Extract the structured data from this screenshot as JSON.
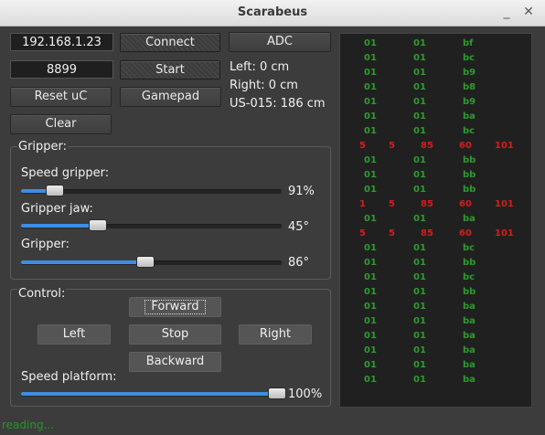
{
  "window": {
    "title": "Scarabeus",
    "minimize_glyph": "_",
    "close_glyph": "✕"
  },
  "connection": {
    "ip": "192.168.1.23",
    "port": "8899",
    "connect_label": "Connect",
    "start_label": "Start",
    "adc_label": "ADC"
  },
  "buttons": {
    "reset_label": "Reset uC",
    "gamepad_label": "Gamepad",
    "clear_label": "Clear"
  },
  "sensors": {
    "left": "Left: 0 cm",
    "right": "Right: 0 cm",
    "us": "US-015: 186 cm"
  },
  "gripper": {
    "title": "Gripper:",
    "speed": {
      "label": "Speed gripper:",
      "value": 0.1,
      "text": "91%"
    },
    "jaw": {
      "label": "Gripper jaw:",
      "value": 0.27,
      "text": "45°"
    },
    "grip": {
      "label": "Gripper:",
      "value": 0.46,
      "text": "86°"
    }
  },
  "control": {
    "title": "Control:",
    "forward": "Forward",
    "left": "Left",
    "stop": "Stop",
    "right": "Right",
    "backward": "Backward",
    "speed_label": "Speed platform:",
    "speed_value": 0.99,
    "speed_text": "100%"
  },
  "console_rows": [
    {
      "kind": "ok",
      "cells": [
        "01",
        "01",
        "bf"
      ]
    },
    {
      "kind": "ok",
      "cells": [
        "01",
        "01",
        "bc"
      ]
    },
    {
      "kind": "ok",
      "cells": [
        "01",
        "01",
        "b9"
      ]
    },
    {
      "kind": "ok",
      "cells": [
        "01",
        "01",
        "b8"
      ]
    },
    {
      "kind": "ok",
      "cells": [
        "01",
        "01",
        "b9"
      ]
    },
    {
      "kind": "ok",
      "cells": [
        "01",
        "01",
        "ba"
      ]
    },
    {
      "kind": "ok",
      "cells": [
        "01",
        "01",
        "bc"
      ]
    },
    {
      "kind": "err",
      "cells": [
        "5",
        "5",
        "85",
        "60",
        "101"
      ]
    },
    {
      "kind": "ok",
      "cells": [
        "01",
        "01",
        "bb"
      ]
    },
    {
      "kind": "ok",
      "cells": [
        "01",
        "01",
        "bb"
      ]
    },
    {
      "kind": "ok",
      "cells": [
        "01",
        "01",
        "bb"
      ]
    },
    {
      "kind": "err",
      "cells": [
        "1",
        "5",
        "85",
        "60",
        "101"
      ]
    },
    {
      "kind": "ok",
      "cells": [
        "01",
        "01",
        "ba"
      ]
    },
    {
      "kind": "err",
      "cells": [
        "5",
        "5",
        "85",
        "60",
        "101"
      ]
    },
    {
      "kind": "ok",
      "cells": [
        "01",
        "01",
        "bc"
      ]
    },
    {
      "kind": "ok",
      "cells": [
        "01",
        "01",
        "bb"
      ]
    },
    {
      "kind": "ok",
      "cells": [
        "01",
        "01",
        "bc"
      ]
    },
    {
      "kind": "ok",
      "cells": [
        "01",
        "01",
        "bb"
      ]
    },
    {
      "kind": "ok",
      "cells": [
        "01",
        "01",
        "ba"
      ]
    },
    {
      "kind": "ok",
      "cells": [
        "01",
        "01",
        "ba"
      ]
    },
    {
      "kind": "ok",
      "cells": [
        "01",
        "01",
        "ba"
      ]
    },
    {
      "kind": "ok",
      "cells": [
        "01",
        "01",
        "ba"
      ]
    },
    {
      "kind": "ok",
      "cells": [
        "01",
        "01",
        "ba"
      ]
    },
    {
      "kind": "ok",
      "cells": [
        "01",
        "01",
        "ba"
      ]
    }
  ],
  "status": "reading...",
  "colors": {
    "ok": "#2e9b2e",
    "err": "#d11f1f",
    "accent": "#3d8ee6"
  }
}
